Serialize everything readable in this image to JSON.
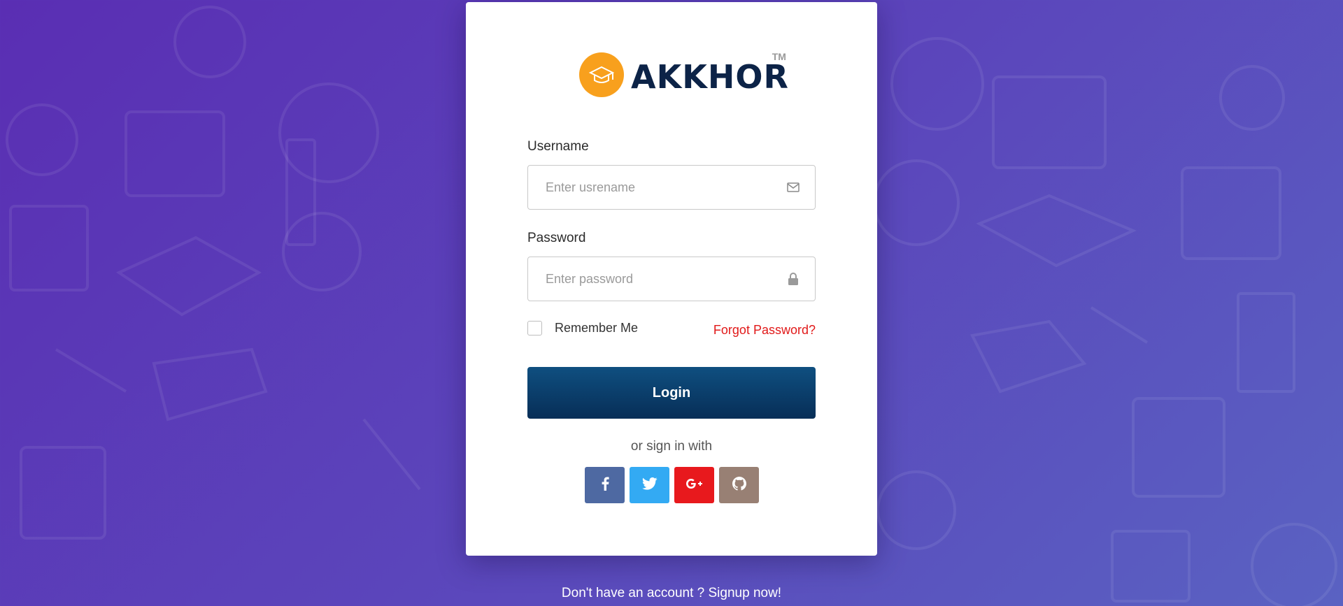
{
  "logo": {
    "text": "AKKHOR",
    "tm": "TM",
    "icon": "graduation-cap-icon"
  },
  "form": {
    "username_label": "Username",
    "username_placeholder": "Enter usrename",
    "password_label": "Password",
    "password_placeholder": "Enter password",
    "remember_label": "Remember Me",
    "forgot_label": "Forgot Password?",
    "login_label": "Login"
  },
  "social": {
    "heading": "or sign in with",
    "buttons": [
      {
        "name": "facebook",
        "icon": "facebook-icon",
        "color": "#3b5998"
      },
      {
        "name": "twitter",
        "icon": "twitter-icon",
        "color": "#1da1f2"
      },
      {
        "name": "google-plus",
        "icon": "google-plus-icon",
        "color": "#e8191d"
      },
      {
        "name": "github",
        "icon": "github-icon",
        "color": "#8d7365"
      }
    ]
  },
  "footer": {
    "signup_text": "Don't have an account ? Signup now!"
  },
  "colors": {
    "background_start": "#5a2eb3",
    "background_end": "#5a62c2",
    "login_button": "#0a3b68",
    "forgot_link": "#e11919",
    "logo_accent": "#f8a01d",
    "logo_text": "#0c2347"
  }
}
